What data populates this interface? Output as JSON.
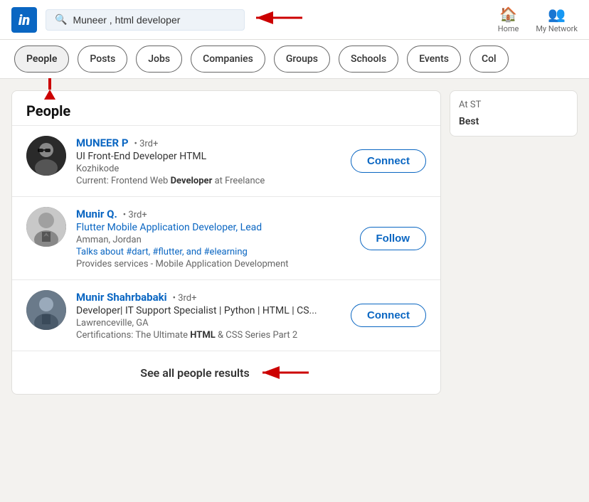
{
  "header": {
    "logo_text": "in",
    "search_value": "Muneer , html developer",
    "nav_items": [
      {
        "id": "home",
        "label": "Home",
        "icon": "🏠"
      },
      {
        "id": "network",
        "label": "My Network",
        "icon": "👥"
      }
    ]
  },
  "filter_tabs": [
    {
      "id": "people",
      "label": "People",
      "active": true
    },
    {
      "id": "posts",
      "label": "Posts",
      "active": false
    },
    {
      "id": "jobs",
      "label": "Jobs",
      "active": false
    },
    {
      "id": "companies",
      "label": "Companies",
      "active": false
    },
    {
      "id": "groups",
      "label": "Groups",
      "active": false
    },
    {
      "id": "schools",
      "label": "Schools",
      "active": false
    },
    {
      "id": "events",
      "label": "Events",
      "active": false
    },
    {
      "id": "col",
      "label": "Col",
      "active": false
    }
  ],
  "people_section": {
    "title": "People",
    "results": [
      {
        "id": "muneer-p",
        "name": "MUNEER P",
        "degree": "• 3rd+",
        "job_title": "UI Front-End Developer HTML",
        "location": "Kozhikode",
        "current": "Current: Frontend Web",
        "current_highlight": "Developer",
        "current_suffix": " at Freelance",
        "action": "Connect"
      },
      {
        "id": "munir-q",
        "name": "Munir Q.",
        "degree": "• 3rd+",
        "job_title": "Flutter Mobile Application Developer, Lead",
        "location": "Amman, Jordan",
        "tags": "Talks about #dart, #flutter, and #elearning",
        "services": "Provides services - Mobile Application Development",
        "action": "Follow"
      },
      {
        "id": "munir-shahrbabaki",
        "name": "Munir Shahrbabaki",
        "degree": "• 3rd+",
        "job_title": "Developer| IT Support Specialist | Python | HTML | CS...",
        "location": "Lawrenceville, GA",
        "cert_prefix": "Certifications: The Ultimate ",
        "cert_highlight": "HTML",
        "cert_suffix": " & CSS Series Part 2",
        "action": "Connect"
      }
    ],
    "see_all_label": "See all people results"
  },
  "sidebar": {
    "at_st": "At ST",
    "best": "Best"
  }
}
